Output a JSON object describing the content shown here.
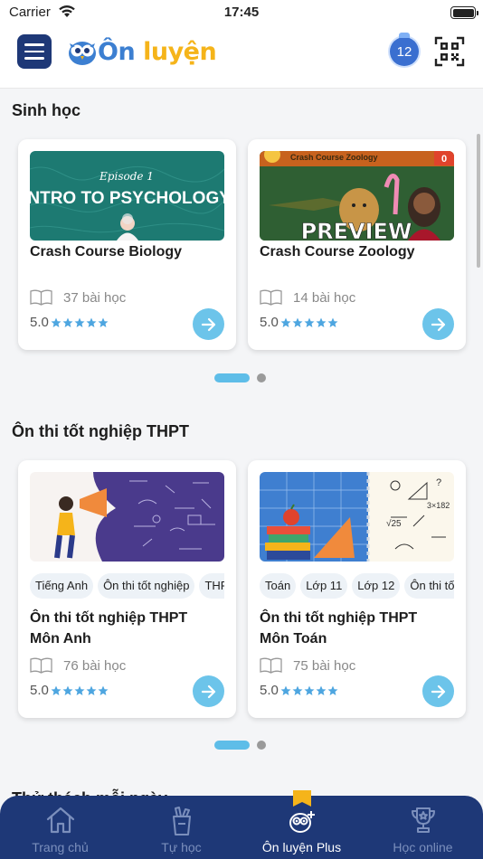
{
  "status_bar": {
    "carrier": "Carrier",
    "time": "17:45"
  },
  "header": {
    "logo_prefix": "Ôn",
    "logo_suffix": " luyện",
    "grade": "12"
  },
  "sections": [
    {
      "title": "Sinh học",
      "cards": [
        {
          "image_caption_small": "Episode 1",
          "image_caption": "INTRO TO PSYCHOLOGY",
          "title": "Crash Course Biology",
          "lessons": "37 bài học",
          "rating": "5.0"
        },
        {
          "image_header": "Crash Course Zoology",
          "image_badge": "0",
          "image_caption": "PREVIEW",
          "title": "Crash Course Zoology",
          "lessons": "14 bài học",
          "rating": "5.0"
        }
      ]
    },
    {
      "title": "Ôn thi tốt nghiệp THPT",
      "cards": [
        {
          "tags": [
            "Tiếng Anh",
            "Ôn thi tốt nghiệp",
            "THPT"
          ],
          "title_line1": "Ôn thi tốt nghiệp THPT",
          "title_line2": "Môn Anh",
          "lessons": "76 bài học",
          "rating": "5.0"
        },
        {
          "tags": [
            "Toán",
            "Lớp 11",
            "Lớp 12",
            "Ôn thi tốt nghiệp"
          ],
          "title_line1": "Ôn thi tốt nghiệp THPT",
          "title_line2": "Môn Toán",
          "lessons": "75 bài học",
          "rating": "5.0"
        }
      ]
    }
  ],
  "next_section_title": "Thử thách mỗi ngày",
  "tabbar": {
    "tabs": [
      {
        "label": "Trang chủ",
        "icon": "home-icon"
      },
      {
        "label": "Tự học",
        "icon": "self-study-icon"
      },
      {
        "label": "Ôn luyện Plus",
        "icon": "owl-plus-icon",
        "active": true
      },
      {
        "label": "Học online",
        "icon": "trophy-icon"
      }
    ]
  },
  "colors": {
    "navy": "#1e3877",
    "accent": "#6cc4ea",
    "star": "#4ea6e0",
    "logo_yellow": "#f5b41a",
    "logo_blue": "#3c7fd1"
  }
}
